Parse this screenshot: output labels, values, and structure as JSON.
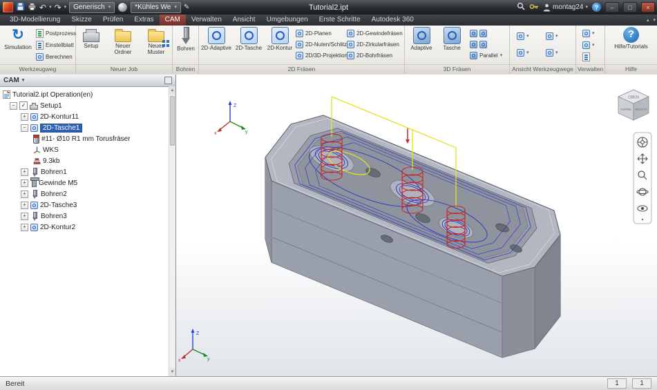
{
  "icons": {
    "caret_down": "▾",
    "caret_up": "▴",
    "undo": "↶",
    "redo": "↷",
    "simulation": "↻",
    "check": "✓",
    "plus": "+",
    "minus": "−",
    "question": "?",
    "edit": "✎",
    "minimize": "–",
    "maximize": "□",
    "close": "×"
  },
  "titlebar": {
    "document_title": "Tutorial2.ipt",
    "material_combo": "Generisch",
    "appearance_combo": "*Kühles We",
    "user_name": "montag24"
  },
  "tabs": [
    {
      "label": "3D-Modellierung"
    },
    {
      "label": "Skizze"
    },
    {
      "label": "Prüfen"
    },
    {
      "label": "Extras"
    },
    {
      "label": "CAM"
    },
    {
      "label": "Verwalten"
    },
    {
      "label": "Ansicht"
    },
    {
      "label": "Umgebungen"
    },
    {
      "label": "Erste Schritte"
    },
    {
      "label": "Autodesk 360"
    }
  ],
  "ribbon": {
    "werkzeugweg": {
      "label": "Werkzeugweg",
      "simulation": "Simulation",
      "postprozess": "Postprozess",
      "einstellblatt": "Einstellblatt",
      "berechnen": "Berechnen"
    },
    "neuer_job": {
      "label": "Neuer Job",
      "setup": "Setup",
      "neuer_ordner": "Neuer Ordner",
      "neues_muster": "Neues Muster"
    },
    "bohren": {
      "label": "Bohren",
      "bohren": "Bohren"
    },
    "fraesen_2d": {
      "label": "2D Fräsen",
      "adaptive": "2D-Adaptive",
      "tasche": "2D-Tasche",
      "kontur": "2D-Kontur",
      "planen": "2D-Planen",
      "nuten_schlitz": "2D-Nuten/Schlitz",
      "projektion": "2D/3D-Projektion",
      "gewindefraesen": "2D-Gewindefräsen",
      "zirkularfraesen": "2D-Zirkularfräsen",
      "bohrfraesen": "2D-Bohrfräsen"
    },
    "fraesen_3d": {
      "label": "3D Fräsen",
      "adaptive": "Adaptive",
      "tasche": "Tasche",
      "parallel": "Parallel"
    },
    "ansicht_werkzeugwege": {
      "label": "Ansicht Werkzeugwege"
    },
    "verwalten": {
      "label": "Verwalten"
    },
    "hilfe": {
      "label": "Hilfe",
      "hilfe_tutorials": "Hilfe/Tutorials"
    }
  },
  "browser": {
    "header": "CAM",
    "root_label": "Tutorial2.ipt Operation(en)",
    "setup1": "Setup1",
    "kontur11": "2D-Kontur11",
    "tasche1": "2D-Tasche1",
    "tool": "#11- Ø10 R1 mm Torusfräser",
    "wks": "WKS",
    "size": "9.3kb",
    "bohren1": "Bohren1",
    "gewinde_m5": "Gewinde M5",
    "bohren2": "Bohren2",
    "tasche3": "2D-Tasche3",
    "bohren3": "Bohren3",
    "kontur2": "2D-Kontur2"
  },
  "viewport": {
    "axis_x": "x",
    "axis_y": "y",
    "axis_z": "Z",
    "viewcube_top": "OBEN",
    "viewcube_front": "VORNE",
    "viewcube_right": "RECHTS",
    "colors": {
      "toolpath_blue": "#2a35c0",
      "rapid_yellow": "#e3e31e",
      "drill_red": "#c62828",
      "part_gray": "#a7adb7"
    }
  },
  "statusbar": {
    "status": "Bereit",
    "num_left": "1",
    "num_right": "1"
  }
}
